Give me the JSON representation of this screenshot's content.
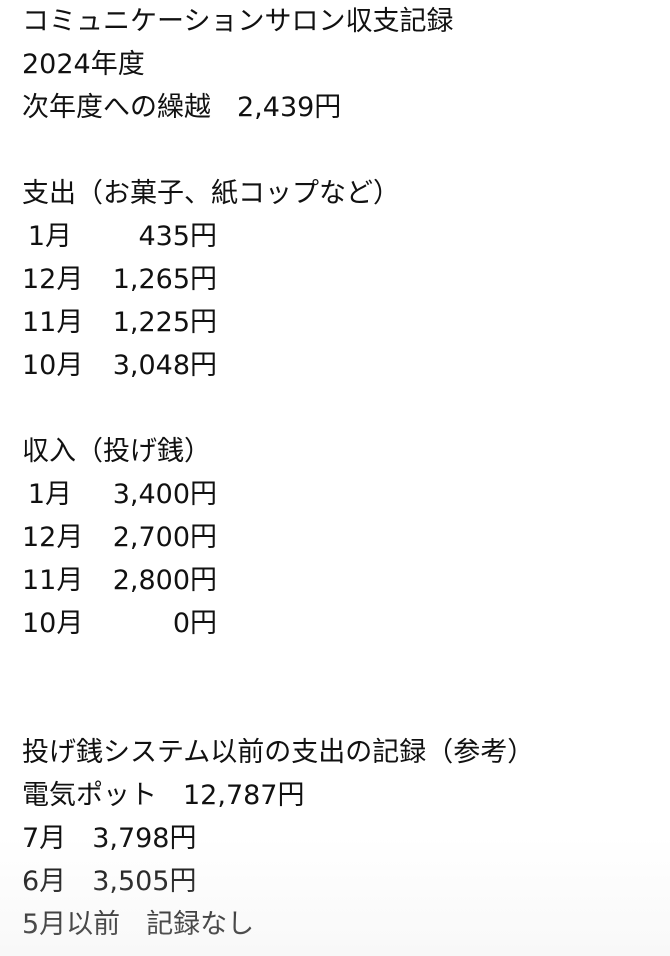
{
  "header": {
    "title": "コミュニケーションサロン収支記録",
    "year": "2024年度",
    "carryover_label": "次年度への繰越",
    "carryover_value": "2,439円"
  },
  "expenses": {
    "heading": "支出（お菓子、紙コップなど）",
    "rows": [
      {
        "month": "1月",
        "amount": "435円"
      },
      {
        "month": "12月",
        "amount": "1,265円"
      },
      {
        "month": "11月",
        "amount": "1,225円"
      },
      {
        "month": "10月",
        "amount": "3,048円"
      }
    ]
  },
  "income": {
    "heading": "収入（投げ銭）",
    "rows": [
      {
        "month": "1月",
        "amount": "3,400円"
      },
      {
        "month": "12月",
        "amount": "2,700円"
      },
      {
        "month": "11月",
        "amount": "2,800円"
      },
      {
        "month": "10月",
        "amount": "0円"
      }
    ]
  },
  "reference": {
    "heading": "投げ銭システム以前の支出の記録（参考）",
    "rows": [
      {
        "label": "電気ポット",
        "amount": "12,787円"
      },
      {
        "label": "7月",
        "amount": "3,798円"
      },
      {
        "label": "6月",
        "amount": "3,505円"
      },
      {
        "label": "5月以前",
        "amount": "記録なし"
      }
    ]
  }
}
